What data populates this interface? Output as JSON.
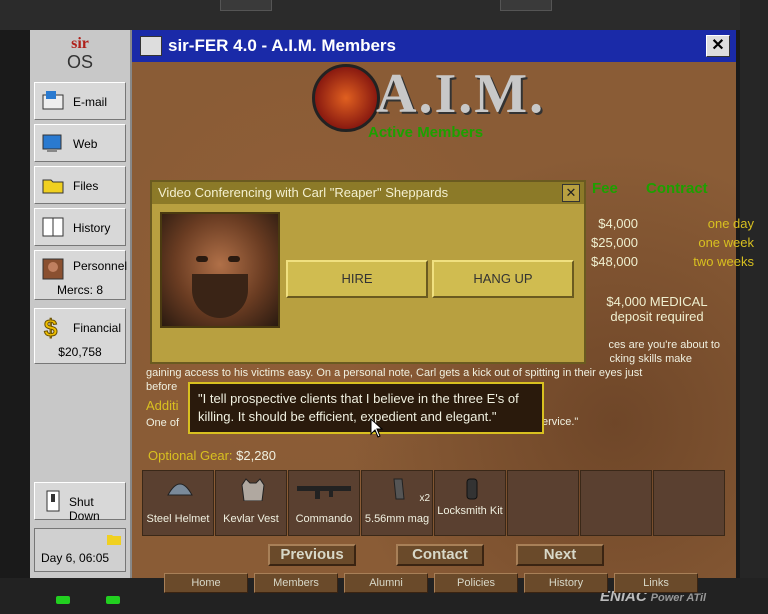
{
  "os": {
    "logo_top": "sir",
    "logo_bottom": "OS"
  },
  "sidebar": {
    "items": [
      {
        "label": "E-mail",
        "icon": "email-icon"
      },
      {
        "label": "Web",
        "icon": "web-icon"
      },
      {
        "label": "Files",
        "icon": "folder-icon"
      },
      {
        "label": "History",
        "icon": "book-icon"
      },
      {
        "label": "Personnel",
        "icon": "person-icon",
        "sub": "Mercs: 8"
      },
      {
        "label": "Financial",
        "icon": "dollar-icon",
        "sub": "$20,758"
      }
    ],
    "shutdown": "Shut Down",
    "date": "Day 6, 06:05"
  },
  "window": {
    "title": "sir-FER 4.0  -  A.I.M. Members"
  },
  "aim": {
    "logo": "A.I.M.",
    "subtitle": "Active Members"
  },
  "fees": {
    "header_fee": "Fee",
    "header_contract": "Contract",
    "rows": [
      {
        "amount": "$4,000",
        "period": "one day"
      },
      {
        "amount": "$25,000",
        "period": "one week"
      },
      {
        "amount": "$48,000",
        "period": "two weeks"
      }
    ],
    "medical_line1": "$4,000 MEDICAL",
    "medical_line2": "deposit required"
  },
  "bio": {
    "right_line1": "ces are you're about to",
    "right_line2": "cking skills make",
    "line3": "gaining access to his victims easy. On a personal note, Carl gets a kick out of spitting in their eyes just",
    "line4": "before",
    "additional": "Additi",
    "one_of": "One of",
    "service": "ervice.\""
  },
  "video": {
    "title": "Video Conferencing with Carl \"Reaper\" Sheppards",
    "hire": "HIRE",
    "hang_up": "HANG UP"
  },
  "quote": "\"I tell prospective clients that I believe in the three E's of killing. It should be efficient, expedient and elegant.\"",
  "gear": {
    "label": "Optional Gear:",
    "price": "$2,280",
    "items": [
      {
        "label": "Steel Helmet",
        "icon": "helmet-icon"
      },
      {
        "label": "Kevlar Vest",
        "icon": "vest-icon"
      },
      {
        "label": "Commando",
        "icon": "rifle-icon"
      },
      {
        "label": "5.56mm mag",
        "icon": "magazine-icon",
        "qty": "x2"
      },
      {
        "label": "Locksmith Kit",
        "icon": "kit-icon"
      }
    ]
  },
  "nav": {
    "previous": "Previous",
    "contact": "Contact",
    "next": "Next"
  },
  "links": [
    "Home",
    "Members",
    "Alumni",
    "Policies",
    "History",
    "Links"
  ],
  "brand": {
    "name": "ENIAC",
    "model": "Power ATil"
  },
  "colors": {
    "titlebar": "#1a2aa8",
    "green_text": "#1da000",
    "gold_text": "#d8c020"
  }
}
